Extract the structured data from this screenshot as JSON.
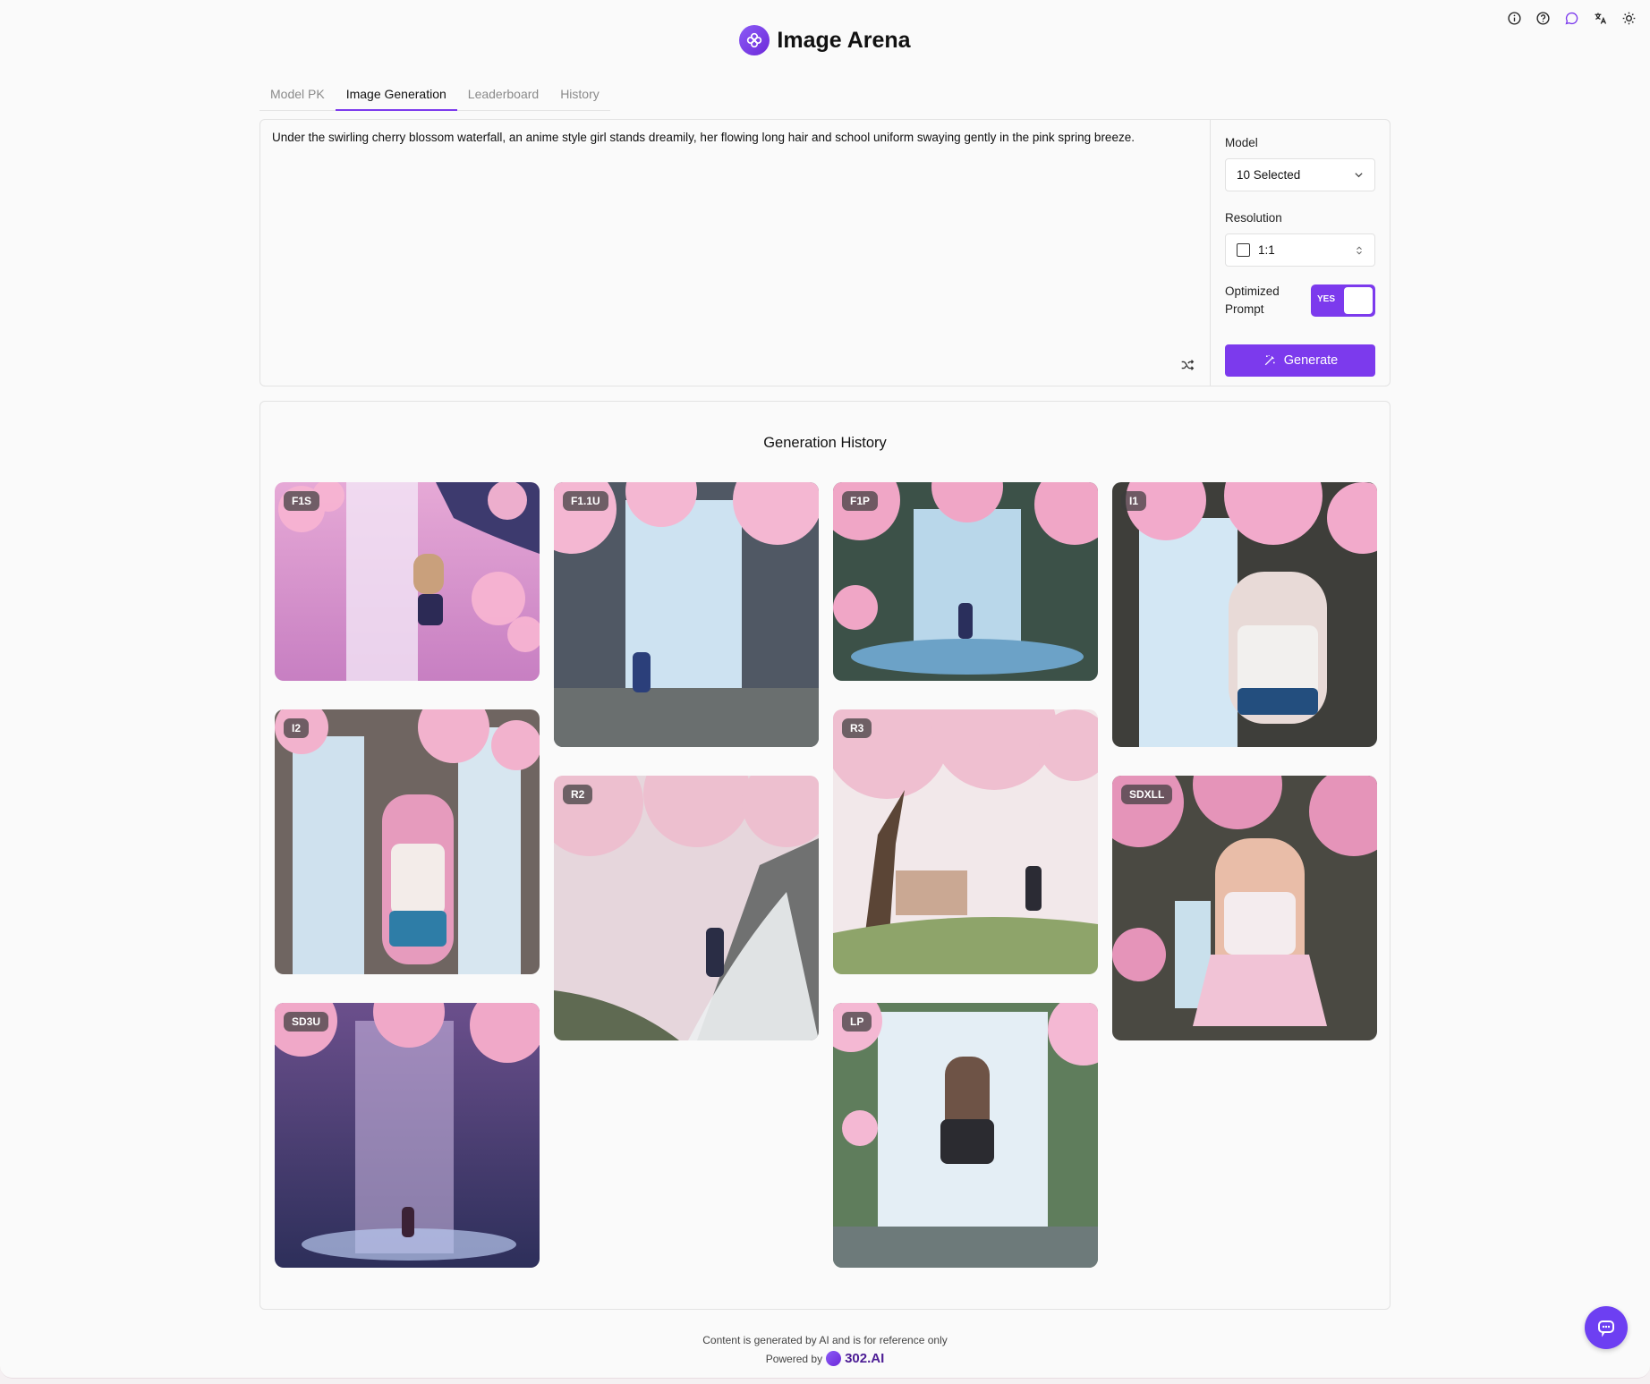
{
  "app": {
    "title": "Image Arena"
  },
  "top_icons": [
    "info-icon",
    "help-icon",
    "chat-bubble-icon",
    "translate-icon",
    "theme-sun-icon"
  ],
  "tabs": [
    {
      "label": "Model PK",
      "active": false
    },
    {
      "label": "Image Generation",
      "active": true
    },
    {
      "label": "Leaderboard",
      "active": false
    },
    {
      "label": "History",
      "active": false
    }
  ],
  "prompt": {
    "text": "Under the swirling cherry blossom waterfall, an anime style girl stands dreamily, her flowing long hair and school uniform swaying gently in the pink spring breeze."
  },
  "settings": {
    "model_label": "Model",
    "model_value": "10 Selected",
    "resolution_label": "Resolution",
    "resolution_value": "1:1",
    "optimized_label_1": "Optimized",
    "optimized_label_2": "Prompt",
    "optimized_toggle": "YES",
    "generate_label": "Generate"
  },
  "history": {
    "title": "Generation History",
    "images": [
      {
        "badge": "F1S"
      },
      {
        "badge": "F1.1U"
      },
      {
        "badge": "F1P"
      },
      {
        "badge": "I1"
      },
      {
        "badge": "I2"
      },
      {
        "badge": "R2"
      },
      {
        "badge": "R3"
      },
      {
        "badge": "SDXLL"
      },
      {
        "badge": "SD3U"
      },
      {
        "badge": "LP"
      }
    ]
  },
  "footer": {
    "disclaimer": "Content is generated by AI and is for reference only",
    "powered_by": "Powered by",
    "brand": "302.AI"
  },
  "colors": {
    "accent": "#7c3aed"
  }
}
